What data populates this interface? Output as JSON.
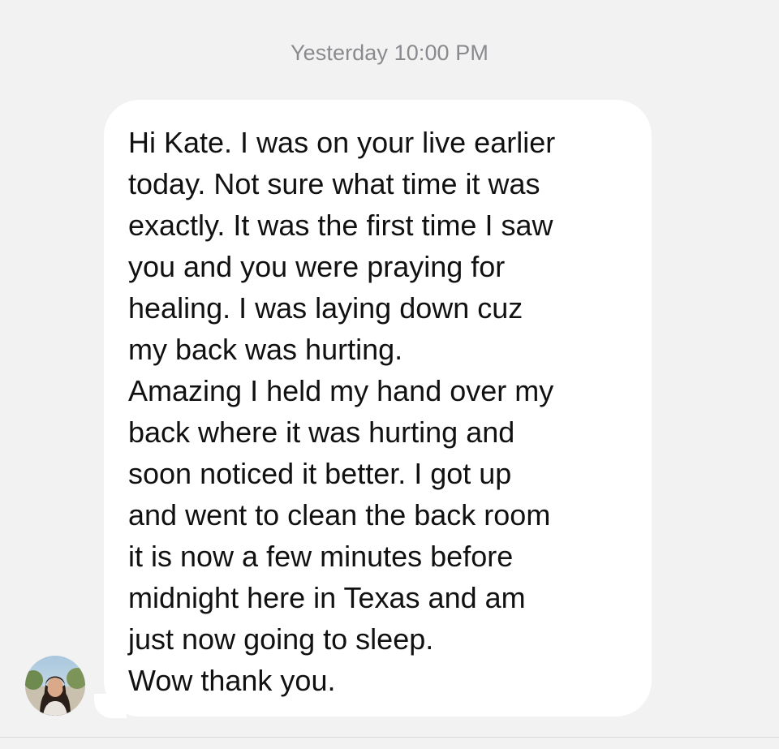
{
  "conversation": {
    "timestamp": "Yesterday 10:00 PM",
    "message": {
      "lines": [
        "Hi Kate. I was on your live earlier",
        "today. Not sure what time it was",
        "exactly. It was the first time I saw",
        "you and you were praying for",
        "healing. I was laying down cuz",
        "my back was hurting.",
        "Amazing I held my hand over my",
        "back where it was hurting and",
        "soon noticed it better. I got up",
        "and went to clean the back room",
        "it is now a few minutes before",
        "midnight here in Texas and am",
        "just now going to sleep.",
        "Wow thank you."
      ]
    },
    "sender": {
      "avatar_icon": "sender-avatar-photo"
    }
  },
  "colors": {
    "background": "#f2f2f2",
    "bubble": "#ffffff",
    "timestamp_text": "#8a8a8e",
    "message_text": "#111111"
  }
}
